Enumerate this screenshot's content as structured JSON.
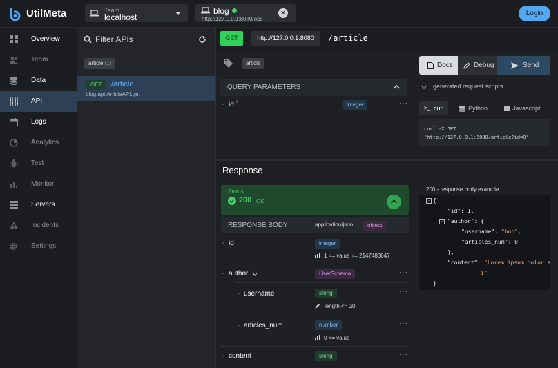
{
  "brand": {
    "name": "UtilMeta"
  },
  "team": {
    "caption": "Team",
    "value": "localhost"
  },
  "project": {
    "name": "blog",
    "url": "http://127.0.0.1:8080/ops"
  },
  "header": {
    "login_label": "Login"
  },
  "sidebar": {
    "items": [
      {
        "label": "Overview",
        "icon": "overview-icon"
      },
      {
        "label": "Team",
        "icon": "team-icon"
      },
      {
        "label": "Data",
        "icon": "database-icon"
      },
      {
        "label": "API",
        "icon": "api-icon"
      },
      {
        "label": "Logs",
        "icon": "logs-icon"
      },
      {
        "label": "Analytics",
        "icon": "analytics-icon"
      },
      {
        "label": "Test",
        "icon": "bug-icon"
      },
      {
        "label": "Monitor",
        "icon": "monitor-icon"
      },
      {
        "label": "Servers",
        "icon": "servers-icon"
      },
      {
        "label": "Incidents",
        "icon": "warning-icon"
      },
      {
        "label": "Settings",
        "icon": "gear-icon"
      }
    ]
  },
  "api_list": {
    "filter_label": "Filter APIs",
    "tag": {
      "name": "article",
      "count": "(1)"
    },
    "items": [
      {
        "method": "GET",
        "path": "/article",
        "func": "blog.api.ArticleAPI.get"
      }
    ]
  },
  "endpoint": {
    "method": "GET",
    "base_url": "http://127.0.0.1:8080",
    "path": "/article",
    "tag": "article"
  },
  "query_params": {
    "title": "QUERY PARAMETERS",
    "params": [
      {
        "name": "id",
        "required_mark": "*",
        "type": "integer",
        "more": "···"
      }
    ]
  },
  "actions": {
    "docs": "Docs",
    "debug": "Debug",
    "send": "Send"
  },
  "scripts": {
    "title": "generated request scripts",
    "tabs": [
      "curl",
      "Python",
      "Javascript"
    ],
    "code_line1": "curl -X GET",
    "code_line2": "'http://127.0.0.1:8080/article?id=0'"
  },
  "response": {
    "title": "Response",
    "status_caption": "Status",
    "status_code": "200",
    "status_text": "OK",
    "body_title": "RESPONSE BODY",
    "content_type": "application/json",
    "body_type": "object",
    "fields": [
      {
        "name": "id",
        "type": "integer",
        "constraint": "1 <= value <= 2147483647"
      },
      {
        "name": "author",
        "type": "UserSchema"
      },
      {
        "name": "username",
        "type": "string",
        "constraint": "length <= 20"
      },
      {
        "name": "articles_num",
        "type": "number",
        "constraint": "0 <= value"
      },
      {
        "name": "content",
        "type": "string"
      }
    ],
    "more": "···"
  },
  "example": {
    "title": "200 - response body example",
    "lines": [
      {
        "t": "{"
      },
      {
        "k": "\"id\"",
        "v": "1",
        "vs": false,
        "tail": ","
      },
      {
        "k": "\"author\"",
        "v": "{",
        "vs": false,
        "tail": ""
      },
      {
        "k": "\"username\"",
        "v": "\"bob\"",
        "vs": true,
        "tail": ","
      },
      {
        "k": "\"articles_num\"",
        "v": "0",
        "vs": false,
        "tail": ""
      },
      {
        "t": "},"
      },
      {
        "k": "\"content\"",
        "v": "\"Lorem ipsum dolor s",
        "vs": true,
        "tail": ""
      },
      {
        "t": "i\""
      },
      {
        "t": "}"
      }
    ]
  },
  "colors": {
    "accent": "#53a8f5",
    "get_green": "#2fd15c",
    "active_bg": "#2d4055"
  }
}
